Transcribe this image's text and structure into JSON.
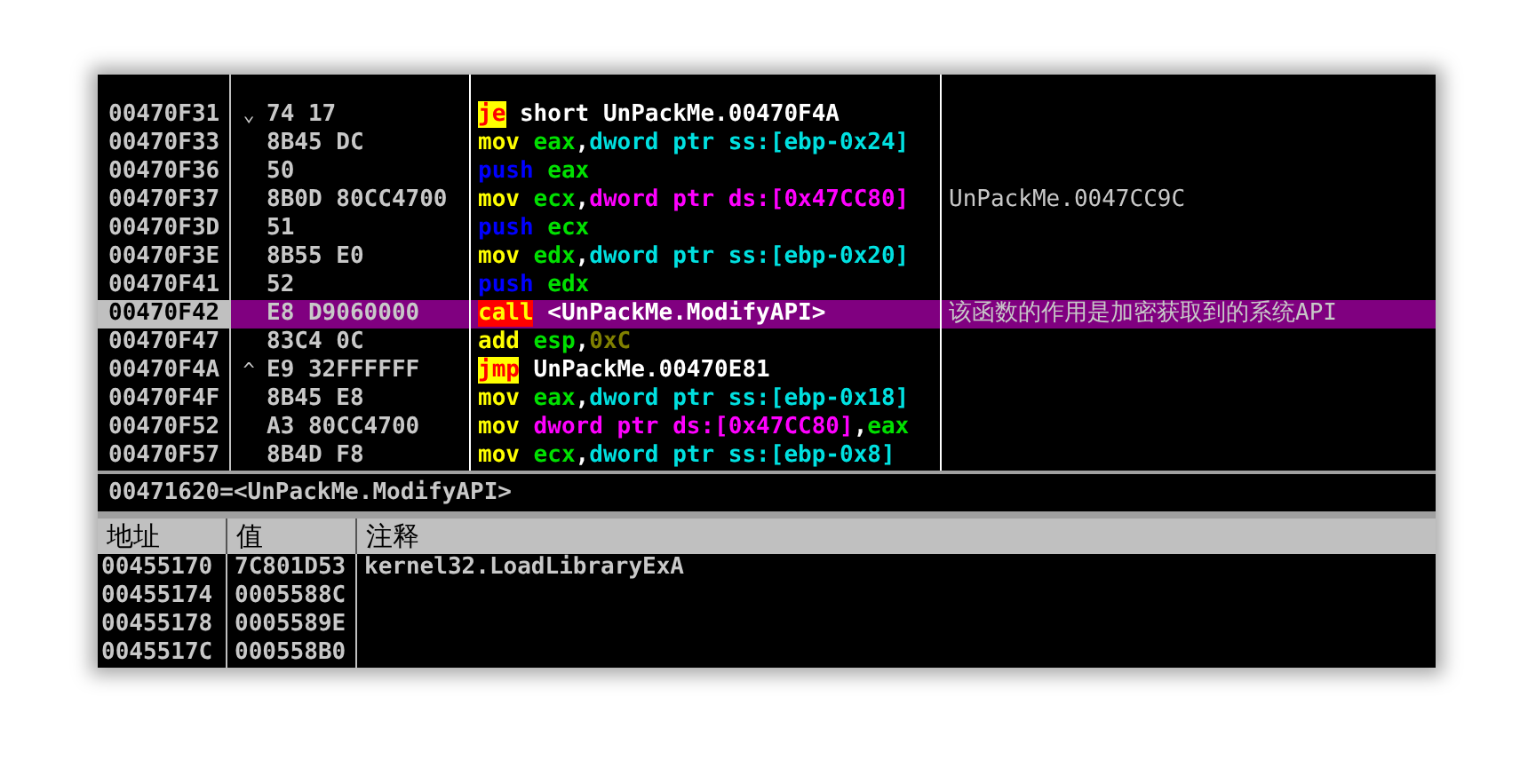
{
  "disassembly": {
    "rows": [
      {
        "address": "00470F31",
        "jump_mark": "⌄",
        "hex": "74 17",
        "selected": false,
        "instruction": [
          {
            "text": "je",
            "kind": "jcc"
          },
          {
            "text": " short UnPackMe.00470F4A",
            "kind": "label"
          }
        ],
        "comment": ""
      },
      {
        "address": "00470F33",
        "jump_mark": "",
        "hex": "8B45 DC",
        "selected": false,
        "instruction": [
          {
            "text": "mov",
            "kind": "op"
          },
          {
            "text": " eax",
            "kind": "reg"
          },
          {
            "text": ",",
            "kind": "label"
          },
          {
            "text": "dword ptr ss:[ebp-0x24]",
            "kind": "stack"
          }
        ],
        "comment": ""
      },
      {
        "address": "00470F36",
        "jump_mark": "",
        "hex": "50",
        "selected": false,
        "instruction": [
          {
            "text": "push",
            "kind": "stackop"
          },
          {
            "text": " eax",
            "kind": "reg"
          }
        ],
        "comment": ""
      },
      {
        "address": "00470F37",
        "jump_mark": "",
        "hex": "8B0D 80CC4700",
        "selected": false,
        "instruction": [
          {
            "text": "mov",
            "kind": "op"
          },
          {
            "text": " ecx",
            "kind": "reg"
          },
          {
            "text": ",",
            "kind": "label"
          },
          {
            "text": "dword ptr ds:[0x47CC80]",
            "kind": "data"
          }
        ],
        "comment": "UnPackMe.0047CC9C"
      },
      {
        "address": "00470F3D",
        "jump_mark": "",
        "hex": "51",
        "selected": false,
        "instruction": [
          {
            "text": "push",
            "kind": "stackop"
          },
          {
            "text": " ecx",
            "kind": "reg"
          }
        ],
        "comment": ""
      },
      {
        "address": "00470F3E",
        "jump_mark": "",
        "hex": "8B55 E0",
        "selected": false,
        "instruction": [
          {
            "text": "mov",
            "kind": "op"
          },
          {
            "text": " edx",
            "kind": "reg"
          },
          {
            "text": ",",
            "kind": "label"
          },
          {
            "text": "dword ptr ss:[ebp-0x20]",
            "kind": "stack"
          }
        ],
        "comment": ""
      },
      {
        "address": "00470F41",
        "jump_mark": "",
        "hex": "52",
        "selected": false,
        "instruction": [
          {
            "text": "push",
            "kind": "stackop"
          },
          {
            "text": " edx",
            "kind": "reg"
          }
        ],
        "comment": ""
      },
      {
        "address": "00470F42",
        "jump_mark": "",
        "hex": "E8 D9060000",
        "selected": true,
        "instruction": [
          {
            "text": "call",
            "kind": "call"
          },
          {
            "text": " <UnPackMe.ModifyAPI>",
            "kind": "label"
          }
        ],
        "comment": "该函数的作用是加密获取到的系统API"
      },
      {
        "address": "00470F47",
        "jump_mark": "",
        "hex": "83C4 0C",
        "selected": false,
        "instruction": [
          {
            "text": "add",
            "kind": "op"
          },
          {
            "text": " esp",
            "kind": "reg"
          },
          {
            "text": ",",
            "kind": "label"
          },
          {
            "text": "0xC",
            "kind": "const"
          }
        ],
        "comment": ""
      },
      {
        "address": "00470F4A",
        "jump_mark": "^",
        "hex": "E9 32FFFFFF",
        "selected": false,
        "instruction": [
          {
            "text": "jmp",
            "kind": "jmp"
          },
          {
            "text": " UnPackMe.00470E81",
            "kind": "label"
          }
        ],
        "comment": ""
      },
      {
        "address": "00470F4F",
        "jump_mark": "",
        "hex": "8B45 E8",
        "selected": false,
        "instruction": [
          {
            "text": "mov",
            "kind": "op"
          },
          {
            "text": " eax",
            "kind": "reg"
          },
          {
            "text": ",",
            "kind": "label"
          },
          {
            "text": "dword ptr ss:[ebp-0x18]",
            "kind": "stack"
          }
        ],
        "comment": ""
      },
      {
        "address": "00470F52",
        "jump_mark": "",
        "hex": "A3 80CC4700",
        "selected": false,
        "instruction": [
          {
            "text": "mov",
            "kind": "op"
          },
          {
            "text": " dword ptr ds:[0x47CC80]",
            "kind": "data"
          },
          {
            "text": ",",
            "kind": "label"
          },
          {
            "text": "eax",
            "kind": "reg"
          }
        ],
        "comment": ""
      },
      {
        "address": "00470F57",
        "jump_mark": "",
        "hex": "8B4D F8",
        "selected": false,
        "instruction": [
          {
            "text": "mov",
            "kind": "op"
          },
          {
            "text": " ecx",
            "kind": "reg"
          },
          {
            "text": ",",
            "kind": "label"
          },
          {
            "text": "dword ptr ss:[ebp-0x8]",
            "kind": "stack"
          }
        ],
        "comment": ""
      }
    ]
  },
  "info_line": "00471620=<UnPackMe.ModifyAPI>",
  "dump": {
    "columns": [
      "地址",
      "值",
      "注释"
    ],
    "rows": [
      {
        "address": "00455170",
        "value": "7C801D53",
        "comment": "kernel32.LoadLibraryExA"
      },
      {
        "address": "00455174",
        "value": "0005588C",
        "comment": ""
      },
      {
        "address": "00455178",
        "value": "0005589E",
        "comment": ""
      },
      {
        "address": "0045517C",
        "value": "000558B0",
        "comment": ""
      }
    ]
  }
}
